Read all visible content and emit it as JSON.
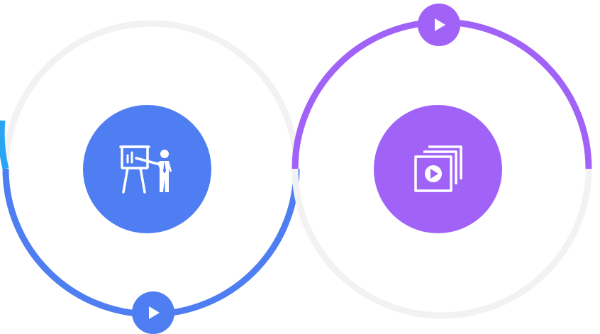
{
  "steps": [
    {
      "id": "presentation",
      "icon": "presentation-icon",
      "accent": "#4f7ef2",
      "progress": 0.5,
      "trail_accent": "#2aa5f2"
    },
    {
      "id": "media",
      "icon": "video-gallery-icon",
      "accent": "#a163f7",
      "progress": 0.5
    }
  ],
  "colors": {
    "track": "#f2f2f2",
    "background": "#ffffff",
    "icon": "#ffffff"
  }
}
